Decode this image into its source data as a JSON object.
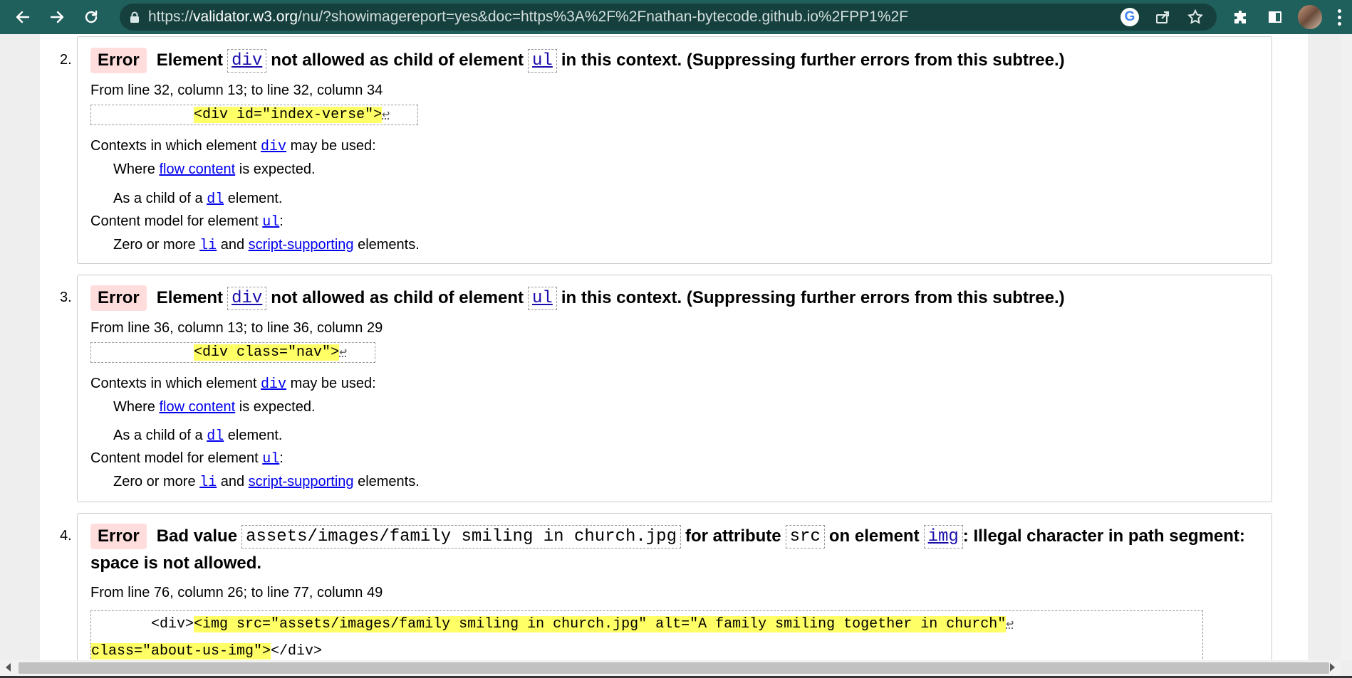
{
  "browser": {
    "url_domain": "validator.w3.org",
    "url_prefix": "https://",
    "url_rest": "/nu/?showimagereport=yes&doc=https%3A%2F%2Fnathan-bytecode.github.io%2FPP1%2F"
  },
  "messages": [
    {
      "number": "2.",
      "type": "Error",
      "title_parts": [
        "Element",
        "div",
        "not allowed as child of element",
        "ul",
        "in this context. (Suppressing further errors from this subtree.)"
      ],
      "location": "From line 32, column 13; to line 32, column 34",
      "extract": "<div id=\"index-verse\">",
      "extract_indent": "            ",
      "ctx_label": "Contexts in which element",
      "ctx_elem": "div",
      "ctx_tail": "may be used:",
      "ctx1_pre": "Where",
      "ctx1_link": "flow content",
      "ctx1_post": "is expected.",
      "ctx2_pre": "As a child of a",
      "ctx2_link": "dl",
      "ctx2_post": "element.",
      "cm_label": "Content model for element",
      "cm_elem": "ul",
      "cm_colon": ":",
      "cm_pre": "Zero or more",
      "cm_link1": "li",
      "cm_mid": "and",
      "cm_link2": "script-supporting",
      "cm_post": "elements."
    },
    {
      "number": "3.",
      "type": "Error",
      "title_parts": [
        "Element",
        "div",
        "not allowed as child of element",
        "ul",
        "in this context. (Suppressing further errors from this subtree.)"
      ],
      "location": "From line 36, column 13; to line 36, column 29",
      "extract": "<div class=\"nav\">",
      "extract_indent": "            ",
      "ctx_label": "Contexts in which element",
      "ctx_elem": "div",
      "ctx_tail": "may be used:",
      "ctx1_pre": "Where",
      "ctx1_link": "flow content",
      "ctx1_post": "is expected.",
      "ctx2_pre": "As a child of a",
      "ctx2_link": "dl",
      "ctx2_post": "element.",
      "cm_label": "Content model for element",
      "cm_elem": "ul",
      "cm_colon": ":",
      "cm_pre": "Zero or more",
      "cm_link1": "li",
      "cm_mid": "and",
      "cm_link2": "script-supporting",
      "cm_post": "elements."
    },
    {
      "number": "4.",
      "type": "Error",
      "title_a": "Bad value",
      "title_code1": "assets/images/family smiling in church.jpg",
      "title_b": "for attribute",
      "title_code2": "src",
      "title_c": "on element",
      "title_code3": "img",
      "title_d": ": Illegal character in path segment:",
      "title_line2": "space is not allowed.",
      "location": "From line 76, column 26; to line 77, column 49",
      "extract_pre": "       <div>",
      "extract_hl1": "<img src=\"assets/images/family smiling in church.jpg\" alt=\"A family smiling together in church\"",
      "extract_hl2": "class=\"about-us-img\">",
      "extract_post": "</div>"
    }
  ]
}
